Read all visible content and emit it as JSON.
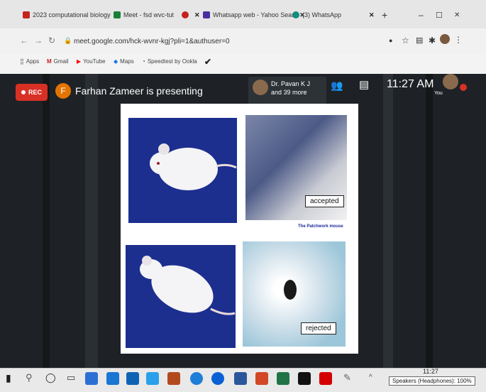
{
  "browser": {
    "tabs": [
      {
        "label": "2023 computational biology",
        "icon_color": "#c5221f"
      },
      {
        "label": "Meet - fsd wvc-tut",
        "icon_color": "#188038"
      },
      {
        "label": "",
        "icon_color": "#c5221f"
      },
      {
        "label": "Whatsapp web - Yahoo Sear",
        "icon_color": "#4a2ea0"
      },
      {
        "label": "(3) WhatsApp",
        "icon_color": "#128c7e"
      }
    ],
    "address": "meet.google.com/hck-wvnr-kgj?pli=1&authuser=0",
    "bookmarks": [
      "Apps",
      "Gmail",
      "YouTube",
      "Maps",
      "Speedtest by Ookla"
    ]
  },
  "meet": {
    "rec_label": "REC",
    "presenter_initial": "F",
    "presenter_text": "Farhan Zameer is presenting",
    "participants_line1": "Dr. Pavan K J",
    "participants_line2": "and 39 more",
    "time": "11:27 AM",
    "self_label": "You"
  },
  "slide": {
    "caption": "The Patchwork mouse",
    "tag_accepted": "accepted",
    "tag_rejected": "rejected"
  },
  "taskbar": {
    "time": "11:27",
    "tooltip": "Speakers (Headphones): 100%"
  },
  "colors": {
    "rec": "#d93025",
    "meet_bg": "#1e2226",
    "slide_bg": "#1c2f8f"
  }
}
